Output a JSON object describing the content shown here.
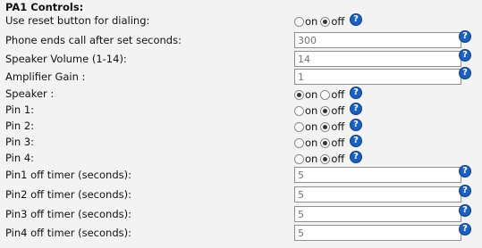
{
  "section": {
    "title": "PA1 Controls:"
  },
  "radio_labels": {
    "on": "on",
    "off": "off"
  },
  "help_glyph": "?",
  "rows": {
    "reset_button": {
      "label": "Use reset button for dialing:",
      "selected": "off"
    },
    "call_end": {
      "label": "Phone ends call after set seconds:",
      "placeholder": "300"
    },
    "speaker_volume": {
      "label": "Speaker Volume (1-14):",
      "placeholder": "14"
    },
    "amplifier_gain": {
      "label": "Amplifier Gain :",
      "placeholder": "1"
    },
    "speaker": {
      "label": "Speaker :",
      "selected": "on"
    },
    "pin1": {
      "label": "Pin 1:",
      "selected": "off"
    },
    "pin2": {
      "label": "Pin 2:",
      "selected": "off"
    },
    "pin3": {
      "label": "Pin 3:",
      "selected": "off"
    },
    "pin4": {
      "label": "Pin 4:",
      "selected": "off"
    },
    "pin1_timer": {
      "label": "Pin1 off timer (seconds):",
      "placeholder": "5"
    },
    "pin2_timer": {
      "label": "Pin2 off timer (seconds):",
      "placeholder": "5"
    },
    "pin3_timer": {
      "label": "Pin3 off timer (seconds):",
      "placeholder": "5"
    },
    "pin4_timer": {
      "label": "Pin4 off timer (seconds):",
      "placeholder": "5"
    }
  },
  "colors": {
    "help_icon": "#1b5fbf",
    "background": "#f3f3f3",
    "input_border": "#8f8f8f"
  }
}
